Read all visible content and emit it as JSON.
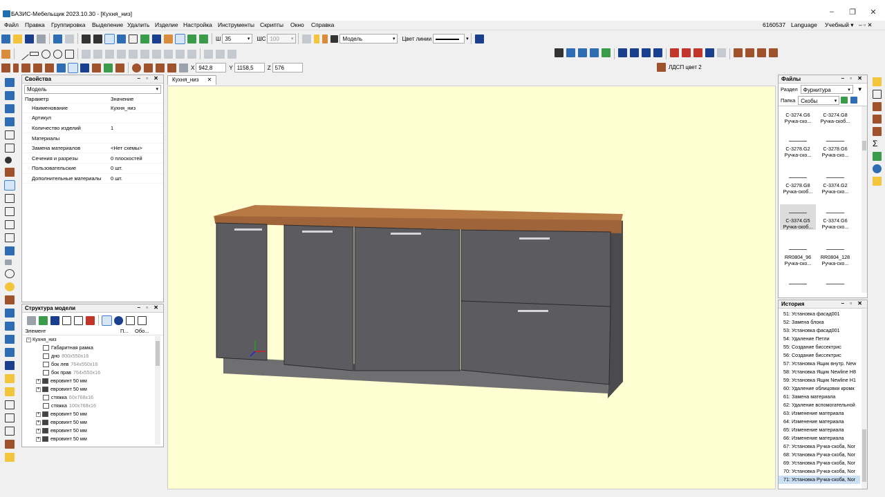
{
  "window": {
    "title": "БАЗИС-Мебельщик 2023.10.30 - [Кухня_низ]",
    "minimize": "–",
    "maximize": "❐",
    "close": "✕"
  },
  "menu": {
    "items": [
      "Файл",
      "Правка",
      "Группировка",
      "Выделение",
      "Удалить",
      "Изделие",
      "Настройка",
      "Инструменты",
      "Скрипты",
      "Окно",
      "Справка"
    ],
    "license": "6160537",
    "language": "Language",
    "mode": "Учебный",
    "mode_caret": "▾",
    "controls": "– ▫ ✕"
  },
  "toolbar1": {
    "width_label": "Ш",
    "width_value": "35",
    "shc_label": "ШС",
    "shc_value": "100",
    "layer_value": "Модель",
    "line_color_label": "Цвет линии"
  },
  "toolbar3": {
    "x_label": "X",
    "x_value": "942,8",
    "y_label": "Y",
    "y_value": "1158,5",
    "z_label": "Z",
    "z_value": "576",
    "material_label": "ЛДСП цвет 2"
  },
  "properties": {
    "title": "Свойства",
    "controls": "– ▫ ✕",
    "object": "Модель",
    "col_param": "Параметр",
    "col_value": "Значение",
    "rows": [
      {
        "k": "Наименование",
        "v": "Кухня_низ"
      },
      {
        "k": "Артикул",
        "v": ""
      },
      {
        "k": "Количество изделий",
        "v": "1"
      },
      {
        "k": "Материалы",
        "v": ""
      },
      {
        "k": "Замена материалов",
        "v": "<Нет схемы>"
      },
      {
        "k": "Сечения и разрезы",
        "v": "0 плоскостей"
      },
      {
        "k": "Пользовательские",
        "v": "0 шт."
      },
      {
        "k": "Дополнительные материалы",
        "v": "0 шт."
      }
    ]
  },
  "structure": {
    "title": "Структура модели",
    "controls": "– ▫ ✕",
    "col_element": "Элемент",
    "col_p": "П...",
    "col_obo": "Обо...",
    "items": [
      {
        "name": "Кухня_низ",
        "dim": "",
        "type": "root"
      },
      {
        "name": "Габаритная рамка",
        "dim": "",
        "type": "frame"
      },
      {
        "name": "дно",
        "dim": "800x550x16",
        "type": "panel"
      },
      {
        "name": "бок лев",
        "dim": "764x550x16",
        "type": "panel"
      },
      {
        "name": "бок прав",
        "dim": "764x550x16",
        "type": "panel"
      },
      {
        "name": "евровинт 50 мм",
        "dim": "",
        "type": "screw"
      },
      {
        "name": "евровинт 50 мм",
        "dim": "",
        "type": "screw"
      },
      {
        "name": "стяжка",
        "dim": "60x768x16",
        "type": "panel"
      },
      {
        "name": "стяжка",
        "dim": "100x768x16",
        "type": "panel"
      },
      {
        "name": "евровинт 50 мм",
        "dim": "",
        "type": "screw"
      },
      {
        "name": "евровинт 50 мм",
        "dim": "",
        "type": "screw"
      },
      {
        "name": "евровинт 50 мм",
        "dim": "",
        "type": "screw"
      },
      {
        "name": "евровинт 50 мм",
        "dim": "",
        "type": "screw"
      }
    ]
  },
  "document": {
    "tab": "Кухня_низ",
    "tab_close": "✕"
  },
  "files": {
    "title": "Файлы",
    "controls": "– ▫ ✕",
    "section_label": "Раздел",
    "section_value": "Фурнитура",
    "folder_label": "Папка",
    "folder_value": "Скобы",
    "items": [
      {
        "code": "С-3274.G6",
        "name": "Ручка-ско..."
      },
      {
        "code": "С-3274.G8",
        "name": "Ручка-скоб..."
      },
      {
        "code": "С-3278.G2",
        "name": "Ручка-ско..."
      },
      {
        "code": "С-3278.G6",
        "name": "Ручка-ско..."
      },
      {
        "code": "С-3278.G8",
        "name": "Ручка-скоб..."
      },
      {
        "code": "С-3374.G2",
        "name": "Ручка-ско..."
      },
      {
        "code": "С-3374.G5",
        "name": "Ручка-скоб..."
      },
      {
        "code": "С-3374.G6",
        "name": "Ручка-ско..."
      },
      {
        "code": "RR0804_96",
        "name": "Ручка-ско..."
      },
      {
        "code": "RR0804_128",
        "name": "Ручка-ско..."
      }
    ]
  },
  "history": {
    "title": "История",
    "controls": "– ▫ ✕",
    "items": [
      "51:  Установка фасад001",
      "52:  Замена блока",
      "53:  Установка фасад001",
      "54:  Удаление Петли",
      "55:  Создание биссектрис",
      "56:  Создание биссектрис",
      "57:  Установка Ящик внутр. New",
      "58:  Установка Ящик Newline H8",
      "59:  Установка Ящик Newline H1",
      "60:  Удаление облицовки кромк",
      "61:  Замена материала",
      "62:  Удаление вспомогательной",
      "63:  Изменение материала",
      "64:  Изменение материала",
      "65:  Изменение материала",
      "66:  Изменение материала",
      "67:  Установка Ручка-скоба, Nor",
      "68:  Установка Ручка-скоба, Nor",
      "69:  Установка Ручка-скоба, Nor",
      "70:  Установка Ручка-скоба, Nor",
      "71:  Установка Ручка-скоба, Nor"
    ]
  },
  "colors": {
    "viewport": "#fffdd2",
    "worktop": "#b07040",
    "cabinet": "#5a5a5e",
    "accent": "#2e6db4"
  }
}
